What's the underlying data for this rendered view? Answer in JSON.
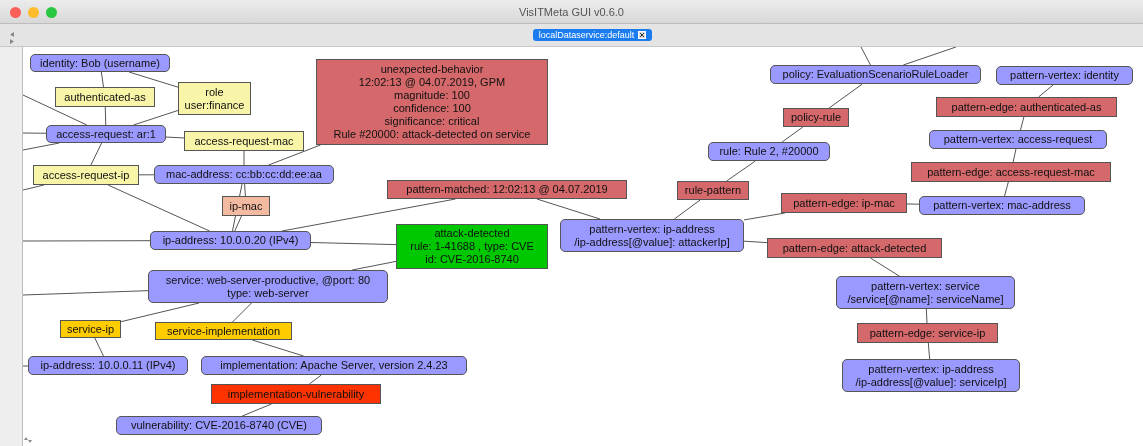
{
  "window": {
    "title": "VisITMeta GUI v0.6.0"
  },
  "tabs": [
    {
      "label": "localDataservice:default",
      "selected": true
    }
  ],
  "graph": {
    "nodes": [
      {
        "kind": "vertex",
        "color": "#9999ff",
        "lines": [
          "identity: Bob (username)"
        ]
      },
      {
        "kind": "link",
        "color": "#f8f4a8",
        "lines": [
          "authenticated-as"
        ]
      },
      {
        "kind": "link",
        "color": "#f8f4a8",
        "lines": [
          "role",
          "user:finance"
        ]
      },
      {
        "kind": "vertex",
        "color": "#9999ff",
        "lines": [
          "access-request: ar:1"
        ]
      },
      {
        "kind": "link",
        "color": "#f8f4a8",
        "lines": [
          "access-request-mac"
        ]
      },
      {
        "kind": "link",
        "color": "#f8f4a8",
        "lines": [
          "access-request-ip"
        ]
      },
      {
        "kind": "vertex",
        "color": "#9999ff",
        "lines": [
          "mac-address: cc:bb:cc:dd:ee:aa"
        ]
      },
      {
        "kind": "link",
        "color": "#f4b9a1",
        "lines": [
          "ip-mac"
        ]
      },
      {
        "kind": "link",
        "color": "#d4686a",
        "lines": [
          "unexpected-behavior",
          "12:02:13 @ 04.07.2019, GPM",
          "magnitude: 100",
          "confidence: 100",
          "significance: critical",
          "Rule #20000: attack-detected on service"
        ]
      },
      {
        "kind": "link",
        "color": "#d4686a",
        "lines": [
          "pattern-matched: 12:02:13 @ 04.07.2019"
        ]
      },
      {
        "kind": "vertex",
        "color": "#9999ff",
        "lines": [
          "ip-address: 10.0.0.20 (IPv4)"
        ]
      },
      {
        "kind": "link",
        "color": "#00c800",
        "lines": [
          "attack-detected",
          "rule: 1-41688 ,  type: CVE",
          "id: CVE-2016-8740"
        ]
      },
      {
        "kind": "vertex",
        "color": "#9999ff",
        "lines": [
          "service: web-server-productive, @port: 80",
          "type: web-server"
        ]
      },
      {
        "kind": "link",
        "color": "#ffcc00",
        "lines": [
          "service-ip"
        ]
      },
      {
        "kind": "link",
        "color": "#ffcc00",
        "lines": [
          "service-implementation"
        ]
      },
      {
        "kind": "vertex",
        "color": "#9999ff",
        "lines": [
          "ip-address: 10.0.0.11 (IPv4)"
        ]
      },
      {
        "kind": "vertex",
        "color": "#9999ff",
        "lines": [
          "implementation: Apache Server, version 2.4.23"
        ]
      },
      {
        "kind": "link",
        "color": "#ff3300",
        "lines": [
          "implementation-vulnerability"
        ]
      },
      {
        "kind": "vertex",
        "color": "#9999ff",
        "lines": [
          "vulnerability: CVE-2016-8740 (CVE)"
        ]
      },
      {
        "kind": "vertex",
        "color": "#9999ff",
        "lines": [
          "policy: EvaluationScenarioRuleLoader"
        ]
      },
      {
        "kind": "vertex",
        "color": "#9999ff",
        "lines": [
          "pattern-vertex: identity"
        ]
      },
      {
        "kind": "link",
        "color": "#d4686a",
        "lines": [
          "policy-rule"
        ]
      },
      {
        "kind": "link",
        "color": "#d4686a",
        "lines": [
          "pattern-edge: authenticated-as"
        ]
      },
      {
        "kind": "vertex",
        "color": "#9999ff",
        "lines": [
          "rule: Rule 2, #20000"
        ]
      },
      {
        "kind": "vertex",
        "color": "#9999ff",
        "lines": [
          "pattern-vertex: access-request"
        ]
      },
      {
        "kind": "link",
        "color": "#d4686a",
        "lines": [
          "pattern-edge: access-request-mac"
        ]
      },
      {
        "kind": "link",
        "color": "#d4686a",
        "lines": [
          "rule-pattern"
        ]
      },
      {
        "kind": "link",
        "color": "#d4686a",
        "lines": [
          "pattern-edge: ip-mac"
        ]
      },
      {
        "kind": "vertex",
        "color": "#9999ff",
        "lines": [
          "pattern-vertex: mac-address"
        ]
      },
      {
        "kind": "vertex",
        "color": "#9999ff",
        "lines": [
          "pattern-vertex: ip-address",
          "/ip-address[@value]: attackerIp]"
        ]
      },
      {
        "kind": "link",
        "color": "#d4686a",
        "lines": [
          "pattern-edge: attack-detected"
        ]
      },
      {
        "kind": "vertex",
        "color": "#9999ff",
        "lines": [
          "pattern-vertex: service",
          "/service[@name]: serviceName]"
        ]
      },
      {
        "kind": "link",
        "color": "#d4686a",
        "lines": [
          "pattern-edge: service-ip"
        ]
      },
      {
        "kind": "vertex",
        "color": "#9999ff",
        "lines": [
          "pattern-vertex: ip-address",
          "/ip-address[@value]: serviceIp]"
        ]
      }
    ]
  }
}
